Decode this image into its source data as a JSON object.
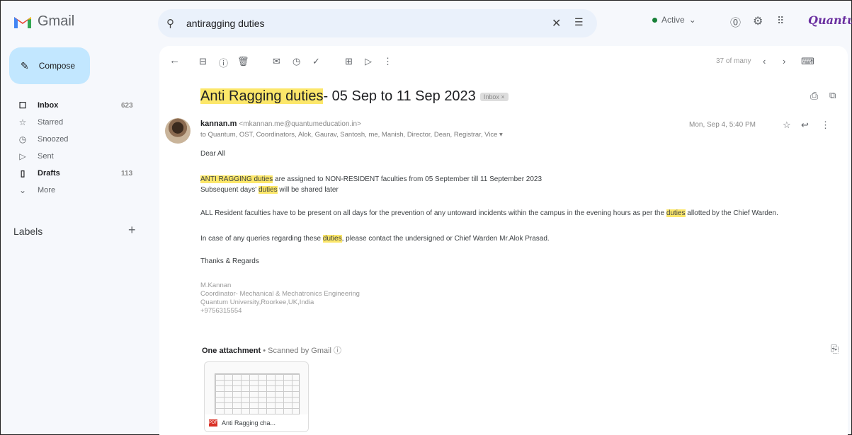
{
  "app": {
    "name": "Gmail",
    "brand": "Quantum"
  },
  "search": {
    "query": "antiragging duties"
  },
  "status": {
    "label": "Active"
  },
  "sidebar": {
    "compose": "Compose",
    "items": [
      {
        "label": "Inbox",
        "count": "623",
        "icon": "inbox-icon",
        "glyph": "☐"
      },
      {
        "label": "Starred",
        "count": "",
        "icon": "star-icon",
        "glyph": "☆"
      },
      {
        "label": "Snoozed",
        "count": "",
        "icon": "clock-icon",
        "glyph": "◷"
      },
      {
        "label": "Sent",
        "count": "",
        "icon": "send-icon",
        "glyph": "▷"
      },
      {
        "label": "Drafts",
        "count": "113",
        "icon": "draft-icon",
        "glyph": "▯"
      },
      {
        "label": "More",
        "count": "",
        "icon": "chevron-down-icon",
        "glyph": "⌄"
      }
    ],
    "labels_heading": "Labels"
  },
  "toolbar": {
    "pagination": "37 of many"
  },
  "email": {
    "subject_hl": "Anti Ragging duties",
    "subject_rest": "- 05 Sep to 11 Sep 2023",
    "inbox_badge": "Inbox ×",
    "sender_name": "kannan.m",
    "sender_email": "<mkannan.me@quantumeducation.in>",
    "recipients": "to Quantum, OST, Coordinators, Alok, Gaurav, Santosh, me, Manish, Director, Dean, Registrar, Vice ▾",
    "date": "Mon, Sep 4, 5:40 PM",
    "greeting": "Dear All",
    "p1_hl1": "ANTI RAGGING duties",
    "p1_rest": " are assigned to NON-RESIDENT faculties from 05 September till 11 September 2023",
    "p2_pre": "Subsequent days' ",
    "p2_hl": "duties",
    "p2_rest": " will be shared later",
    "p3_pre": "ALL Resident faculties have to be present on all days for the prevention of any untoward incidents within the campus in the evening hours as per the ",
    "p3_hl": "duties",
    "p3_rest": " allotted by the Chief Warden.",
    "p4_pre": "In case of any queries regarding these ",
    "p4_hl": "duties",
    "p4_rest": ", please contact the undersigned or Chief Warden Mr.Alok Prasad.",
    "closing": "Thanks & Regards",
    "sig1": "M.Kannan",
    "sig2": "Coordinator- Mechanical & Mechatronics Engineering",
    "sig3": "Quantum University,Roorkee,UK,India",
    "sig4": "+9756315554"
  },
  "attachment": {
    "heading": "One attachment",
    "scanned": "• Scanned by Gmail ⓘ",
    "filename": "Anti Ragging cha..."
  }
}
